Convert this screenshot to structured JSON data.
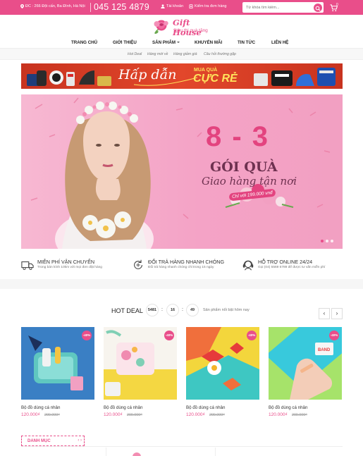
{
  "topbar": {
    "address": "ĐC : 266 Đội cấn, Ba Đình, Hà Nội",
    "phone": "045 125 4879",
    "account": "Tài khoản",
    "order_check": "Kiểm tra đơn hàng",
    "search_placeholder": "Từ khóa tìm kiếm...",
    "cart_count": "0"
  },
  "logo": {
    "brand": "Gift House",
    "tagline": "Siêu thị quà tặng"
  },
  "nav": {
    "items": [
      "TRANG CHỦ",
      "GIỚI THIỆU",
      "SẢN PHẨM",
      "KHUYẾN MÃI",
      "TIN TỨC",
      "LIÊN HỆ"
    ]
  },
  "subnav": {
    "items": [
      "Hot Deal",
      "Hàng mới về",
      "Hàng giảm giá",
      "Câu hỏi thường gặp"
    ]
  },
  "promo": {
    "headline": "Hấp dẫn",
    "sub1": "MUA QUÀ",
    "sub2": "CỰC RẺ"
  },
  "hero": {
    "date": "8 - 3",
    "gift": "GÓI QUÀ",
    "shipping": "Giao hàng tận nơi",
    "price_tag": "Chỉ với 199.000 vnđ",
    "slide_count": 3,
    "active_slide": 1
  },
  "services": [
    {
      "title": "MIỄN PHÍ VẬN CHUYỂN",
      "desc": "Trong bán kính 10km với mọi đơn đặt hàng",
      "icon": "truck-icon"
    },
    {
      "title": "ĐỔI TRẢ HÀNG NHANH CHÓNG",
      "desc": "Đổi trả hàng nhanh chóng chỉ trong 15 ngày",
      "icon": "return-icon"
    },
    {
      "title": "HỖ TRỢ ONLINE 24/24",
      "desc": "Gọi (04) 5569 6789 để được tư vấn miễn phí",
      "icon": "support-icon"
    }
  ],
  "hotdeal": {
    "title": "HOT DEAL",
    "countdown": [
      "5481",
      "16",
      "49"
    ],
    "note": "Sản phẩm nổi bật hôm nay",
    "prev": "‹",
    "next": "›"
  },
  "products": [
    {
      "name": "Bộ đồ dùng cá nhân",
      "price": "120.000₫",
      "old_price": "200.000₫",
      "discount": "-40%"
    },
    {
      "name": "Bộ đồ dùng cá nhân",
      "price": "120.000₫",
      "old_price": "200.000₫",
      "discount": "-40%"
    },
    {
      "name": "Bộ đồ dùng cá nhân",
      "price": "120.000₫",
      "old_price": "200.000₫",
      "discount": "-40%"
    },
    {
      "name": "Bộ đồ dùng cá nhân",
      "price": "120.000₫",
      "old_price": "200.000₫",
      "discount": "-40%"
    }
  ],
  "category": {
    "title": "DANH MỤC",
    "arrows": "‹ ›"
  },
  "colors": {
    "brand_pink": "#e94e8a",
    "promo_red": "#d43c24",
    "hero_pink": "#f4a3c6"
  }
}
